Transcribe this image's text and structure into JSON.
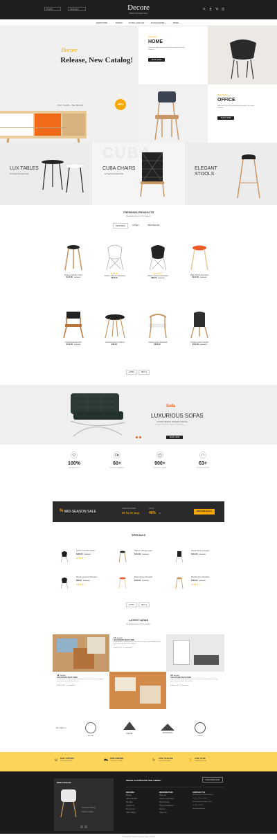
{
  "header": {
    "lang": "English",
    "currency": "Language",
    "logo": "Decore",
    "tagline": "Modern Furniture Store",
    "icons": [
      "search-icon",
      "user-icon",
      "cart-icon",
      "menu-icon"
    ]
  },
  "nav": {
    "items": [
      "FURNITURE ⌄",
      "DINING",
      "LIVING & DECOR",
      "ACCESSORIES ⌄",
      "MORE ⌄"
    ]
  },
  "hero": {
    "brand": "Decore",
    "title": "Release, New Catalog!",
    "tagline": "YOU THINK, WE BUILD",
    "badge": "49%",
    "badge_sub": "off",
    "dots": 2
  },
  "banners": {
    "home": {
      "kicker": "New Stock",
      "title": "HOME",
      "text": "Make your Home Furnishing with Ensemble Decorated Products",
      "cta": "SHOP NOW"
    },
    "office": {
      "kicker": "New Catalog",
      "title": "OFFICE",
      "text": "Make your Office Furnishing with Ensemble Decorated Products",
      "cta": "SHOP NOW"
    }
  },
  "categories": [
    {
      "title": "LUX TABLES",
      "sub": "STYLES COLLECTION"
    },
    {
      "title": "CUBA CHAIRS",
      "sub": "STYLES COLLECTION",
      "bg": "CUBA"
    },
    {
      "title": "ELEGANT\nSTOOLS",
      "sub": ""
    }
  ],
  "trending": {
    "title": "TRENDING PRODUCTS",
    "subtitle": "Bestselling Items In This Season",
    "tabs": [
      "FEATURED",
      "LATEST",
      "BESTSELLER"
    ],
    "products": [
      {
        "name": "Shabeer Daringle Collez",
        "price": "$144.00",
        "old": "$160.00",
        "stars": ""
      },
      {
        "name": "Aliquam Quaerat Voluptatem",
        "price": "$122.00",
        "old": "",
        "stars": "★★★★☆"
      },
      {
        "name": "Aliquam Quaerat Voluptatem",
        "price": "$98.00",
        "old": "$122.00",
        "stars": "★★★★☆"
      },
      {
        "name": "Magni Dolores Eosquam",
        "price": "$113.00",
        "old": "$125.00",
        "stars": ""
      },
      {
        "name": "Voluptati Nula Besilium",
        "price": "$112.00",
        "old": "$128.00",
        "stars": ""
      },
      {
        "name": "Tempora Incidunt Ustabore",
        "price": "$98.00",
        "old": "",
        "stars": ""
      },
      {
        "name": "Aliquam Quae Voluptatem",
        "price": "$242.00",
        "old": "",
        "stars": ""
      },
      {
        "name": "Occasus Cuple Cuippad",
        "price": "$103.00",
        "old": "$112.00",
        "stars": ""
      }
    ],
    "prev": "◂ PREV",
    "next": "NEXT ▸"
  },
  "sofa": {
    "kicker": "Sofa",
    "title": "LUXURIOUS SOFAS",
    "sub": "LUXURY DESIGN ON NEW CATALOG",
    "text": "Furniture is Vitals for Products and Clients",
    "cta": "SHOP NOW"
  },
  "stats": [
    {
      "num": "100%",
      "label": "SATISFACTION",
      "icon": "heart-icon"
    },
    {
      "num": "60+",
      "label": "PRODUCT BRANDS",
      "icon": "truck-icon"
    },
    {
      "num": "900+",
      "label": "PRODUCT SALES",
      "icon": "bag-icon"
    },
    {
      "num": "63+",
      "label": "ONLINE SUPPORT",
      "icon": "headset-icon"
    }
  ],
  "sale": {
    "title": "MID-SEASON SALE",
    "starting": "STARTING FROM:",
    "dates": "09 To 29 July",
    "upto": "UP TO",
    "pct": "40%",
    "off": "off",
    "cta": "EXPLORE DEALS"
  },
  "specials": {
    "title": "SPECIALS",
    "items": [
      {
        "name": "Aspiano Surcjabi Golbigh",
        "price": "$402.00",
        "old": "$480.00",
        "stars": "★★★★☆"
      },
      {
        "name": "Shabeer Daringle Collez",
        "price": "$144.00",
        "old": "$160.00",
        "stars": ""
      },
      {
        "name": "Wilmolt Pilorul Sertagard",
        "price": "$144.00",
        "old": "$160.00",
        "stars": ""
      },
      {
        "name": "Aliquam Quaerat Voluptatem",
        "price": "$98.00",
        "old": "$122.00",
        "stars": "★★★★☆"
      },
      {
        "name": "Magni Dolores Eosquam",
        "price": "$113.00",
        "old": "$125.00",
        "stars": ""
      },
      {
        "name": "Maintain Fore Flamsdam",
        "price": "$103.00",
        "old": "$112.00",
        "stars": "★★★★☆"
      }
    ],
    "prev": "◂ PREV",
    "next": "NEXT ▸"
  },
  "news": {
    "title": "LATEST NEWS",
    "subtitle": "Bestselling Items In This Season",
    "posts": [
      {
        "day": "10",
        "month": "JANUARY",
        "title": "VOLUPTATE VELIT ESSE",
        "text": "Lorem ipsum is simply dummy text of the printing and typesetting industry lorem ipsum has been the industry.",
        "author": "Steve Job",
        "comments": "Comments"
      },
      {
        "day": "18",
        "month": "JANUARY",
        "title": "VOLUPTATE VELIT ESSE",
        "text": "Lorem ipsum is simply dummy text of the printing and typesetting industry lorem ipsum has been the industry.",
        "author": "Steve Job",
        "comments": "Comments"
      },
      {
        "day": "18",
        "month": "JANUARY",
        "title": "VOLUPTATE VELIT ESSE",
        "text": "Lorem ipsum is simply dummy text of the printing and typesetting industry lorem ipsum has been the industry.",
        "author": "Steve Job",
        "comments": "Comments"
      }
    ]
  },
  "brands": [
    "The Coffee Co",
    "ALLURE",
    "TRAVEL",
    "MOUNTAIN",
    "SINCE"
  ],
  "services": [
    {
      "title": "DAILY SUPPORT",
      "sub": "24/7 Support Team",
      "icon": "phone-icon"
    },
    {
      "title": "FREE SHIPPING",
      "sub": "On Order Over $99",
      "icon": "truck-icon"
    },
    {
      "title": "LOVE TO SHARE",
      "sub": "Share with Friends",
      "icon": "share-icon"
    },
    {
      "title": "LOVE TO WE",
      "sub": "Good News to You",
      "icon": "thumb-icon"
    }
  ],
  "footer": {
    "catalog": "NEW CATALOG",
    "catalog_links": [
      "Download Catalog",
      "Explore Catalog"
    ],
    "question": "WANTS TO PURCHASE OUR THEME?",
    "purchase": "PURCHASE NOW",
    "col1": {
      "title": "DECORA",
      "links": [
        "Brands",
        "Gift Certificates",
        "Site Map",
        "Contact Us",
        "My Account",
        "Order History"
      ]
    },
    "col2": {
      "title": "INFORMATION",
      "links": [
        "About Us",
        "Delivery Information",
        "Privacy Policy",
        "Terms & Conditions",
        "Returns",
        "Order List"
      ]
    },
    "col3": {
      "title": "CONTACT US",
      "lines": [
        "Hallstatt Demo, Ground, Decore",
        "Furniture Stores Street,",
        "Boulevard Street, Apple Street",
        "+1 800 123 4567",
        "info@example.com"
      ]
    },
    "copyright": "Powered By OpenCart Decore Store © 2024"
  },
  "colors": {
    "accent": "#f6a800",
    "dark": "#1e1e1e",
    "sale_red": "#e85d1d",
    "yellow": "#fcd45a"
  }
}
